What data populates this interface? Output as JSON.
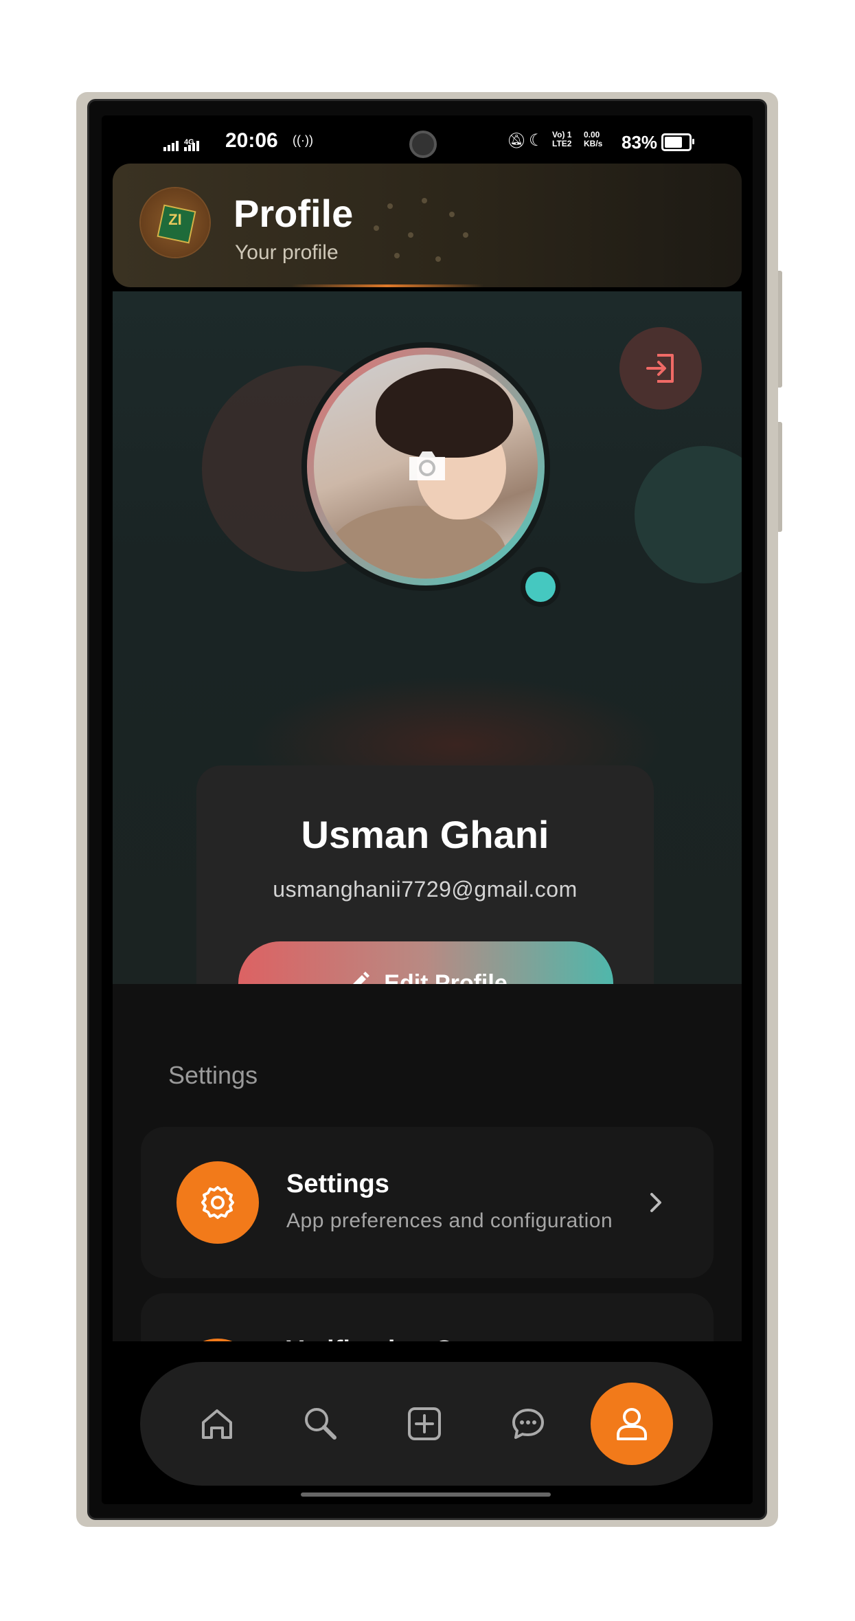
{
  "status_bar": {
    "time": "20:06",
    "network": "4G",
    "battery_percent": "83%",
    "battery_level": 0.83,
    "volte": "Vo) 1 LTE2",
    "speed": "0.00 KB/s"
  },
  "header": {
    "title": "Profile",
    "subtitle": "Your profile",
    "logo_text": "ZI"
  },
  "profile": {
    "name": "Usman Ghani",
    "email": "usmanghanii7729@gmail.com",
    "edit_label": "Edit Profile",
    "online": true
  },
  "settings": {
    "section_label": "Settings",
    "items": [
      {
        "title": "Settings",
        "subtitle": "App preferences and configuration",
        "icon": "gear-icon"
      },
      {
        "title": "Verification Center",
        "subtitle": "",
        "icon": "verify-icon"
      }
    ]
  },
  "nav": {
    "items": [
      {
        "name": "home",
        "icon": "home-icon"
      },
      {
        "name": "search",
        "icon": "search-icon"
      },
      {
        "name": "create",
        "icon": "plus-square-icon"
      },
      {
        "name": "messages",
        "icon": "chat-icon"
      },
      {
        "name": "profile",
        "icon": "user-icon",
        "active": true
      }
    ]
  },
  "colors": {
    "accent": "#f27a1a",
    "gradient_start": "#dc6263",
    "gradient_end": "#4fb7ab",
    "online": "#45c8c0"
  }
}
